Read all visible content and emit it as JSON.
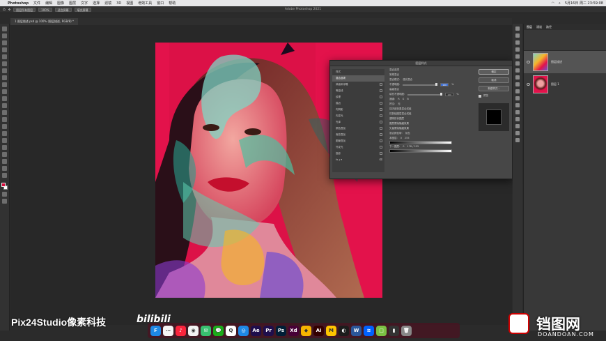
{
  "menubar": {
    "app_name": "Photoshop",
    "items": [
      "文件",
      "编辑",
      "图像",
      "图层",
      "文字",
      "选择",
      "滤镜",
      "3D",
      "视图",
      "增效工具",
      "窗口",
      "帮助"
    ],
    "clock": "5月16日 周二 23:59:08"
  },
  "optbar": {
    "window_title": "Adobe Photoshop 2021",
    "buttons": [
      "图层所有图层",
      "100%",
      "适合屏幕",
      "填充屏幕"
    ]
  },
  "document_tab": "1 图层描述.psd @ 100% (图层描述, RGB/8) *",
  "layers_panel": {
    "tabs": [
      "图层",
      "通道",
      "路径"
    ],
    "layers": [
      {
        "name": "图层描述",
        "selected": true
      },
      {
        "name": "图层 1",
        "selected": false
      }
    ]
  },
  "dialog": {
    "title": "图层样式",
    "sidebar": [
      {
        "label": "样式",
        "check": false
      },
      {
        "label": "混合选项",
        "check": false,
        "selected": true
      },
      {
        "label": "斜面和浮雕",
        "check": true
      },
      {
        "label": "等高线",
        "check": true
      },
      {
        "label": "纹理",
        "check": true
      },
      {
        "label": "描边",
        "check": true
      },
      {
        "label": "内阴影",
        "check": true
      },
      {
        "label": "内发光",
        "check": true
      },
      {
        "label": "光泽",
        "check": true
      },
      {
        "label": "颜色叠加",
        "check": true
      },
      {
        "label": "渐变叠加",
        "check": true
      },
      {
        "label": "图案叠加",
        "check": true
      },
      {
        "label": "外发光",
        "check": true
      },
      {
        "label": "投影",
        "check": true
      }
    ],
    "main": {
      "section1": "混合选项",
      "section1_sub": "常规混合",
      "blend_mode_label": "混合模式:",
      "blend_mode_value": "强光混合",
      "opacity_label": "不透明度:",
      "opacity_value": "100",
      "section2": "高级混合",
      "fill_label": "填充不透明度:",
      "fill_value": "100",
      "channels_label": "通道:",
      "channels": [
        "R",
        "G",
        "B"
      ],
      "knockout_label": "挖空:",
      "knockout_value": "无",
      "options": [
        "将内部效果混合成组",
        "将剪贴图层混合成组",
        "透明形状图层",
        "图层蒙版隐藏效果",
        "矢量蒙版隐藏效果"
      ],
      "blend_if_label": "混合颜色带:",
      "blend_if_value": "灰色",
      "this_layer_label": "本图层:",
      "this_layer_vals": [
        "0",
        "255"
      ],
      "under_layer_label": "下一图层:",
      "under_layer_vals": [
        "0",
        "178 / 255"
      ]
    },
    "buttons": [
      "确定",
      "取消",
      "新建样式...",
      "预览"
    ]
  },
  "dock": {
    "apps": [
      {
        "label": "F",
        "color": "#1e88e5"
      },
      {
        "label": "⋯",
        "color": "#f5f5f5"
      },
      {
        "label": "♪",
        "color": "#fa243c"
      },
      {
        "label": "◉",
        "color": "#f2f2f2"
      },
      {
        "label": "✉",
        "color": "#38c06f"
      },
      {
        "label": "💬",
        "color": "#1aad19"
      },
      {
        "label": "Q",
        "color": "#ffffff"
      },
      {
        "label": "◎",
        "color": "#1e88e5"
      },
      {
        "label": "Ae",
        "color": "#1f0e4c"
      },
      {
        "label": "Pr",
        "color": "#1f0e4c"
      },
      {
        "label": "Ps",
        "color": "#001e36"
      },
      {
        "label": "Xd",
        "color": "#470137"
      },
      {
        "label": "◆",
        "color": "#f7b500"
      },
      {
        "label": "Ai",
        "color": "#330000"
      },
      {
        "label": "M",
        "color": "#ffc400"
      },
      {
        "label": "◐",
        "color": "#1c1c1c"
      },
      {
        "label": "W",
        "color": "#2b579a"
      },
      {
        "label": "≋",
        "color": "#0061ff"
      },
      {
        "label": "□",
        "color": "#7bc043"
      },
      {
        "label": "▮",
        "color": "#333333"
      },
      {
        "label": "🗑",
        "color": "#888888"
      }
    ]
  },
  "watermarks": {
    "left": "Pix24Studio像素科技",
    "bili": "bilibili",
    "right_big": "铛图网",
    "right_small": "DOANDOAN.COM"
  }
}
